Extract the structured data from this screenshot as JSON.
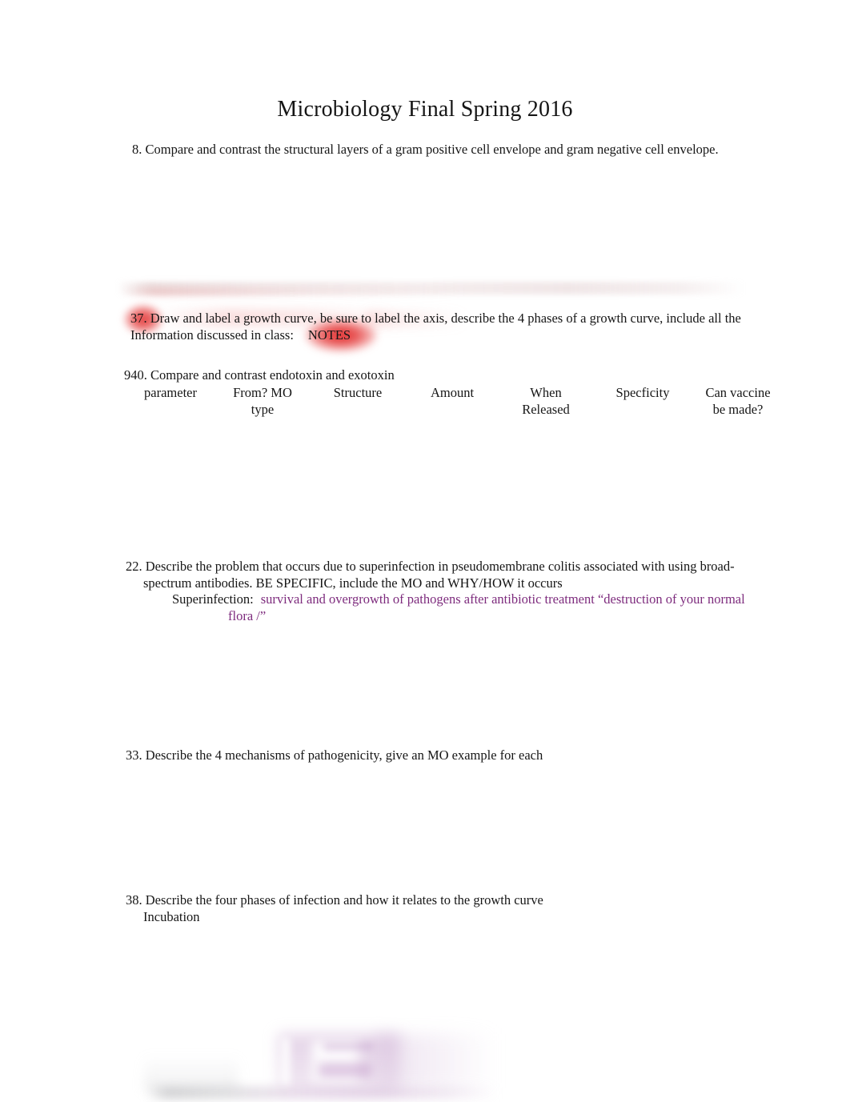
{
  "document": {
    "title": "Microbiology Final Spring 2016"
  },
  "questions": {
    "q8": {
      "line1": "8. Compare and contrast the structural layers of a gram positive cell envelope and gram negative cell envelope."
    },
    "q37": {
      "line1": "37. Draw and label a growth curve, be sure to label the axis, describe the 4 phases of a growth curve, include all the",
      "line2_a": "Information discussed in class:",
      "line2_highlight": "NOTES",
      "highlight_color": "#e02020",
      "number_highlighted": "37."
    },
    "q940": {
      "line1": "940. Compare and contrast endotoxin and exotoxin"
    },
    "q22": {
      "line1": "22. Describe the problem that occurs due to superinfection in pseudomembrane colitis associated with using broad-",
      "line2": "spectrum antibodies. BE SPECIFIC, include the MO and WHY/HOW it occurs",
      "line3_label": "Superinfection:",
      "line3_answer": "survival and overgrowth of pathogens after antibiotic treatment “destruction of your normal",
      "line4_answer": "flora /”",
      "answer_color": "#7d2b7d"
    },
    "q33": {
      "line1": "33. Describe the 4 mechanisms of pathogenicity, give an MO example for each"
    },
    "q38": {
      "line1": "38. Describe the four phases of infection and how it relates to the growth curve",
      "line2": "Incubation"
    }
  },
  "endotoxin_exotoxin_table": {
    "headers": [
      "parameter",
      "From? MO\ntype",
      "Structure",
      "Amount",
      "When\nReleased",
      "Specficity",
      "Can vaccine\nbe made?"
    ],
    "rows": []
  }
}
